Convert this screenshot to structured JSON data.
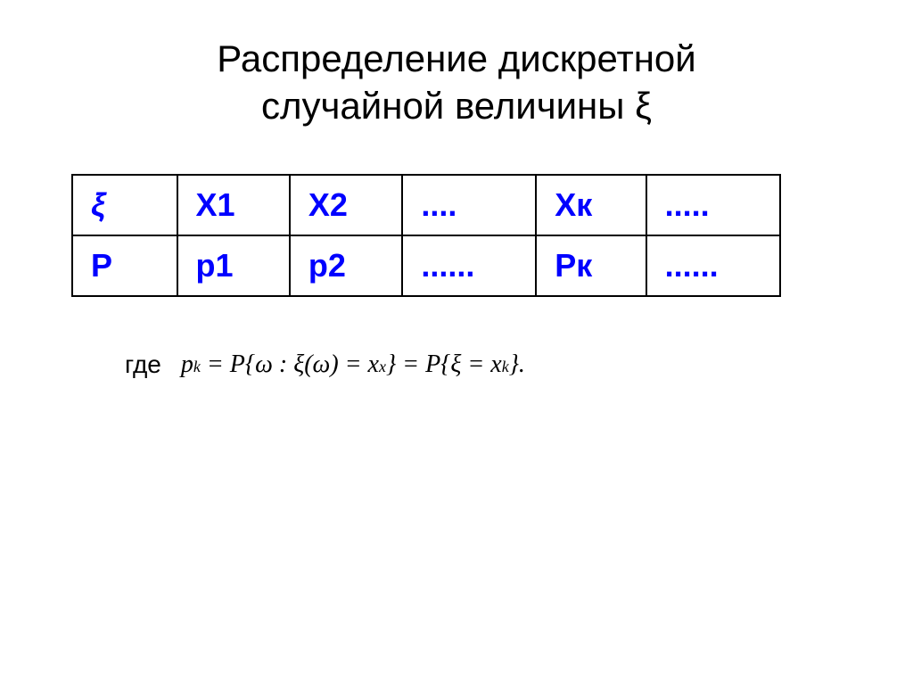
{
  "page": {
    "background": "#ffffff"
  },
  "title": {
    "line1": "Распределение дискретной",
    "line2": "случайной величины ξ"
  },
  "table": {
    "headers": [
      "ξ",
      "X1",
      "X2",
      "....",
      "Xк",
      "....."
    ],
    "row2": [
      "P",
      "p1",
      "p2",
      "......",
      "Pк",
      "......"
    ]
  },
  "formula": {
    "where_label": "где",
    "expression": "p_k = P{ω : ξ(ω) = x_x} = P{ξ = x_k}."
  }
}
